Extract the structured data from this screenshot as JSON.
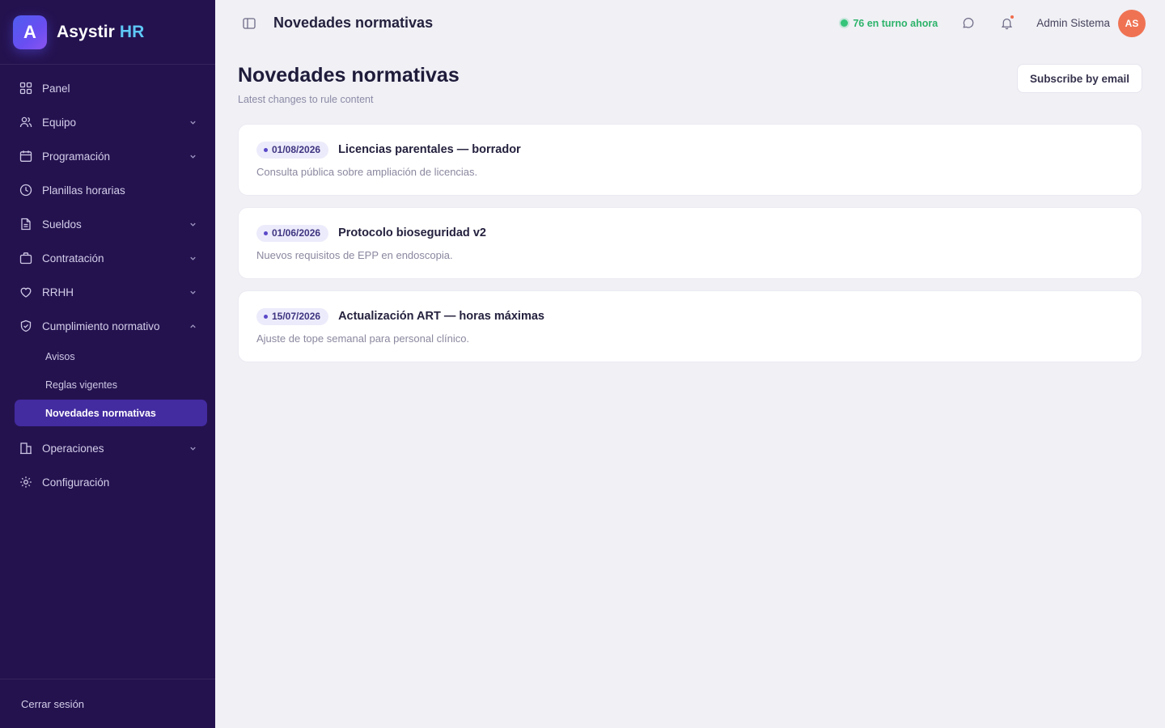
{
  "brand": {
    "logo_letter": "A",
    "name": "Asystir",
    "accent": "HR"
  },
  "sidebar": {
    "items": [
      {
        "label": "Panel",
        "icon": "grid-icon",
        "has_chevron": false
      },
      {
        "label": "Equipo",
        "icon": "users-icon",
        "has_chevron": true
      },
      {
        "label": "Programación",
        "icon": "calendar-icon",
        "has_chevron": true
      },
      {
        "label": "Planillas horarias",
        "icon": "clock-icon",
        "has_chevron": false
      },
      {
        "label": "Sueldos",
        "icon": "document-icon",
        "has_chevron": true
      },
      {
        "label": "Contratación",
        "icon": "briefcase-icon",
        "has_chevron": true
      },
      {
        "label": "RRHH",
        "icon": "heart-icon",
        "has_chevron": true
      },
      {
        "label": "Cumplimiento normativo",
        "icon": "shield-check-icon",
        "has_chevron": true,
        "expanded": true
      },
      {
        "label": "Operaciones",
        "icon": "building-icon",
        "has_chevron": true
      },
      {
        "label": "Configuración",
        "icon": "gear-icon",
        "has_chevron": false
      }
    ],
    "subitems": [
      {
        "label": "Avisos",
        "active": false
      },
      {
        "label": "Reglas vigentes",
        "active": false
      },
      {
        "label": "Novedades normativas",
        "active": true
      }
    ],
    "logout_label": "Cerrar sesión"
  },
  "topbar": {
    "title": "Novedades normativas",
    "on_shift": "76 en turno ahora",
    "user_name": "Admin Sistema",
    "avatar_initials": "AS"
  },
  "page": {
    "title": "Novedades normativas",
    "subtitle": "Latest changes to rule content",
    "subscribe_label": "Subscribe by email"
  },
  "updates": [
    {
      "date": "01/08/2026",
      "title": "Licencias parentales — borrador",
      "description": "Consulta pública sobre ampliación de licencias."
    },
    {
      "date": "01/06/2026",
      "title": "Protocolo bioseguridad v2",
      "description": "Nuevos requisitos de EPP en endoscopia."
    },
    {
      "date": "15/07/2026",
      "title": "Actualización ART — horas máximas",
      "description": "Ajuste de tope semanal para personal clínico."
    }
  ],
  "colors": {
    "sidebar_bg": "#24124f",
    "active_item_bg": "#432ba0",
    "brand_accent": "#5ec8f5",
    "status_green": "#2db36a",
    "avatar_bg": "#ef7353",
    "badge_bg": "#ecebfb"
  }
}
